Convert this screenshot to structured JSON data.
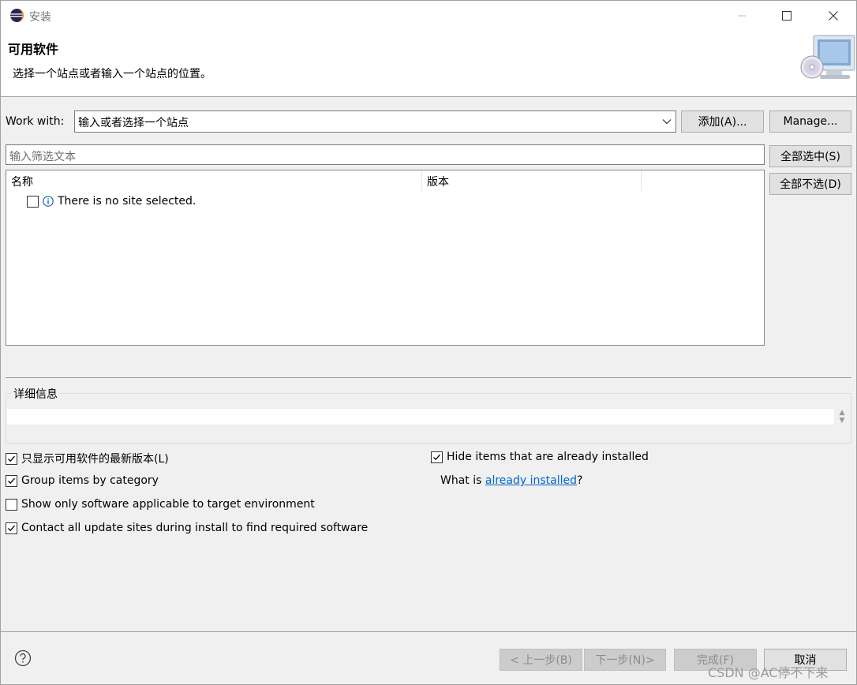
{
  "window": {
    "title": "安装"
  },
  "banner": {
    "title": "可用软件",
    "description": "选择一个站点或者输入一个站点的位置。"
  },
  "work_with": {
    "label": "Work with:",
    "placeholder": "输入或者选择一个站点",
    "add_button": "添加(A)...",
    "manage_button": "Manage..."
  },
  "filter": {
    "placeholder": "输入筛选文本"
  },
  "table": {
    "columns": [
      "名称",
      "版本"
    ],
    "rows": [
      {
        "checked": false,
        "text": "There is no site selected."
      }
    ]
  },
  "side_buttons": {
    "select_all": "全部选中(S)",
    "deselect_all": "全部不选(D)"
  },
  "details": {
    "label": "详细信息"
  },
  "options": {
    "latest_only": {
      "label": "只显示可用软件的最新版本(L)",
      "checked": true
    },
    "group_by_category": {
      "label": "Group items by category",
      "checked": true
    },
    "target_env_only": {
      "label": "Show only software applicable to target environment",
      "checked": false
    },
    "contact_all_sites": {
      "label": "Contact all update sites during install to find required software",
      "checked": true
    },
    "hide_installed": {
      "label": "Hide items that are already installed",
      "checked": true
    },
    "what_is_prefix": "What is ",
    "what_is_link": "already installed",
    "what_is_suffix": "?"
  },
  "footer": {
    "back_button": "< 上一步(B)",
    "next_button": "下一步(N)>",
    "finish_button": "完成(F)",
    "cancel_button": "取消",
    "watermark": "CSDN @AC停不下来"
  }
}
